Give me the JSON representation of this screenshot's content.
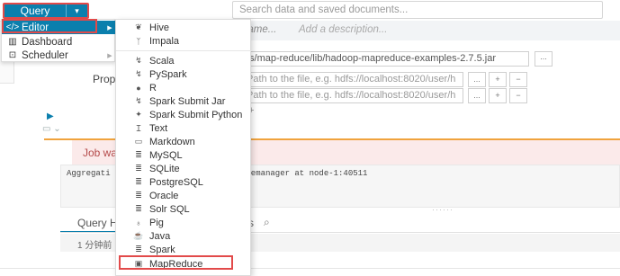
{
  "topbar": {
    "query_label": "Query",
    "query_caret": "▾",
    "search_placeholder": "Search data and saved documents..."
  },
  "background": {
    "name_placeholder": "name...",
    "description_placeholder": "Add a description...",
    "jar_path": "/s/map-reduce/lib/hadoop-mapreduce-examples-2.7.5.jar",
    "jar_browse_label": "...",
    "properties_label": "Prope",
    "path_placeholder": "Path to the file, e.g. hdfs://localhost:8020/user/h",
    "path_browse_label": "...",
    "add_symbol": "+",
    "remove_symbol": "−",
    "play_symbol": "▶",
    "snippet_toggle": "▭ ⌄",
    "plus_symbol": "+",
    "job_status_text": "Job was",
    "log_line_left": "Aggregati",
    "log_line_right": "odemanager at node-1:40511",
    "resize_handle": "······",
    "history_tab_label": "Query His",
    "tab_s_label": "s",
    "search_icon_glyph": "⌕",
    "history_time": "1 分钟前"
  },
  "left_menu": {
    "items": [
      {
        "icon": "</>",
        "label": "Editor",
        "arrow": "▶"
      },
      {
        "icon": "▥",
        "label": "Dashboard",
        "arrow": ""
      },
      {
        "icon": "⊡",
        "label": "Scheduler",
        "arrow": "▶"
      }
    ]
  },
  "editor_submenu": {
    "items": [
      {
        "icon": "❦",
        "label": "Hive"
      },
      {
        "icon": "ᛉ",
        "label": "Impala"
      },
      {
        "icon": "↯",
        "label": "Scala"
      },
      {
        "icon": "↯",
        "label": "PySpark"
      },
      {
        "icon": "●",
        "label": "R"
      },
      {
        "icon": "↯",
        "label": "Spark Submit Jar"
      },
      {
        "icon": "✦",
        "label": "Spark Submit Python"
      },
      {
        "icon": "Ｉ",
        "label": "Text"
      },
      {
        "icon": "▭",
        "label": "Markdown"
      },
      {
        "icon": "≣",
        "label": "MySQL"
      },
      {
        "icon": "≣",
        "label": "SQLite"
      },
      {
        "icon": "≣",
        "label": "PostgreSQL"
      },
      {
        "icon": "≣",
        "label": "Oracle"
      },
      {
        "icon": "≣",
        "label": "Solr SQL"
      },
      {
        "icon": "♁",
        "label": "Pig"
      },
      {
        "icon": "☕",
        "label": "Java"
      },
      {
        "icon": "≣",
        "label": "Spark"
      },
      {
        "icon": "▣",
        "label": "MapReduce"
      }
    ]
  },
  "colors": {
    "accent": "#0b7fad",
    "highlight_border": "#e24a4a",
    "warning_line": "#f0a33d"
  }
}
